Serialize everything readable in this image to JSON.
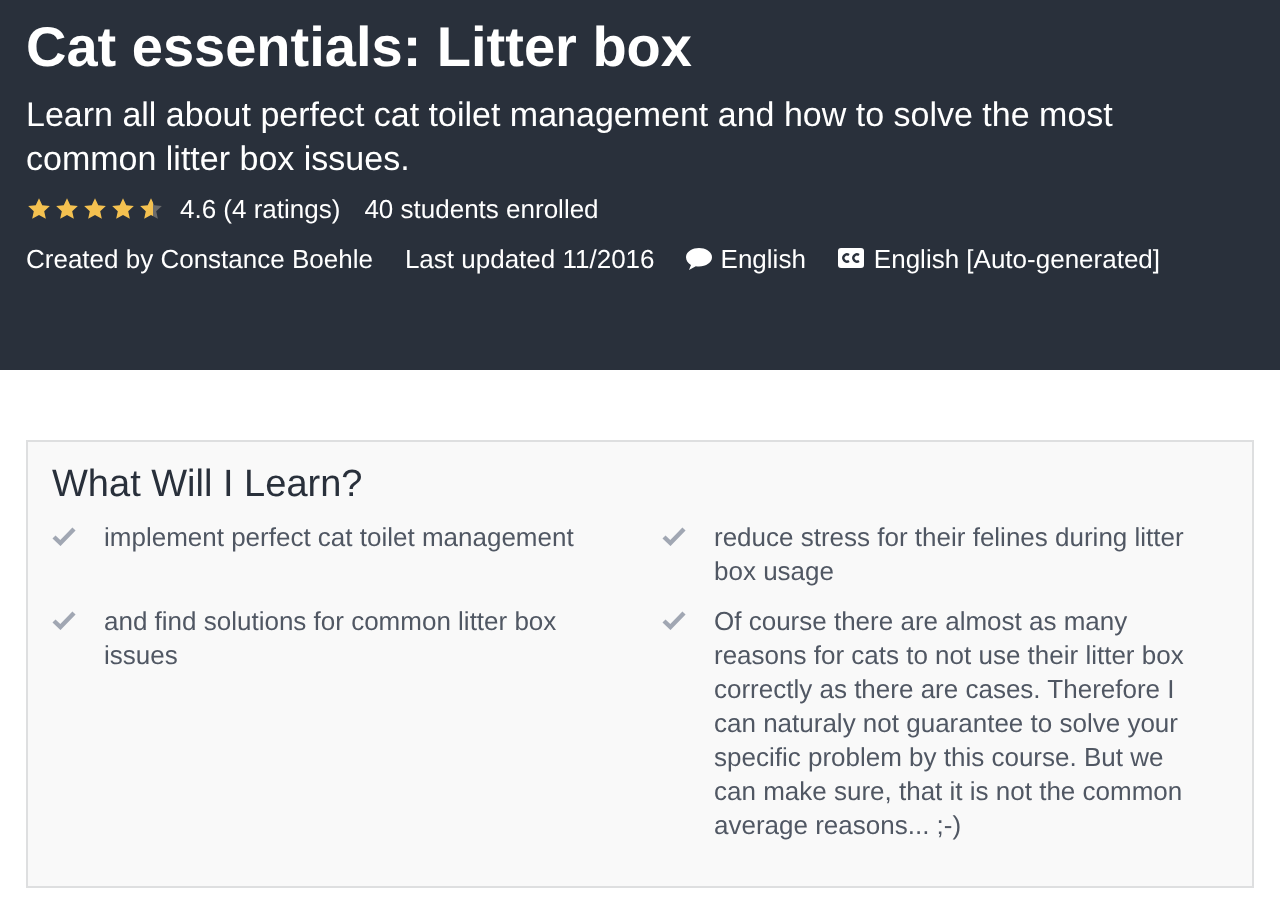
{
  "header": {
    "title": "Cat essentials: Litter box",
    "subtitle": "Learn all about perfect cat toilet management and how to solve the most common litter box issues.",
    "stars": 4.6,
    "rating": "4.6 (4 ratings)",
    "enrolled": "40 students enrolled",
    "author": "Created by Constance Boehle",
    "updated": "Last updated 11/2016",
    "language": "English",
    "captions": "English [Auto-generated]"
  },
  "learn": {
    "title": "What Will I Learn?",
    "items": [
      {
        "text": "implement perfect cat toilet management"
      },
      {
        "text": "reduce stress for their felines during litter box usage"
      },
      {
        "text": "and find solutions for common litter box issues"
      },
      {
        "text": "Of course there are almost as many reasons for cats to not use their litter box correctly as there are cases. Therefore I can naturaly not guarantee to solve your specific problem by this course. But we can make sure, that it is not the common average reasons... ;-)"
      }
    ]
  }
}
